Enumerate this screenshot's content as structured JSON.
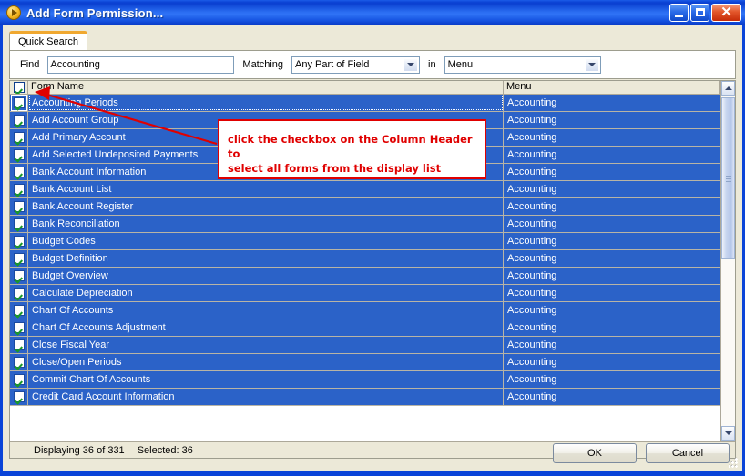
{
  "window": {
    "title": "Add Form Permission...",
    "icon": "play-circle-icon",
    "minimize_label": "Minimize",
    "maximize_label": "Maximize",
    "close_label": "Close",
    "titlebar_color": "#0a44d8",
    "client_color": "#ece9d8"
  },
  "tabs": [
    {
      "label": "Quick Search",
      "active": true,
      "accent_color": "#f0a830"
    }
  ],
  "search": {
    "find_label": "Find",
    "find_value": "Accounting",
    "find_placeholder": "",
    "matching_label": "Matching",
    "matching_value": "Any Part of Field",
    "in_label": "in",
    "in_value": "Menu"
  },
  "grid": {
    "select_all_checked": true,
    "columns": [
      {
        "key": "check",
        "label": ""
      },
      {
        "key": "name",
        "label": "Form Name"
      },
      {
        "key": "menu",
        "label": "Menu"
      }
    ],
    "row_color": "#2b62c8",
    "row_text_color": "#ffffff",
    "rows": [
      {
        "checked": true,
        "name": "Accounting Periods",
        "menu": "Accounting"
      },
      {
        "checked": true,
        "name": "Add Account Group",
        "menu": "Accounting"
      },
      {
        "checked": true,
        "name": "Add Primary Account",
        "menu": "Accounting"
      },
      {
        "checked": true,
        "name": "Add Selected Undeposited Payments",
        "menu": "Accounting"
      },
      {
        "checked": true,
        "name": "Bank Account Information",
        "menu": "Accounting"
      },
      {
        "checked": true,
        "name": "Bank Account List",
        "menu": "Accounting"
      },
      {
        "checked": true,
        "name": "Bank Account Register",
        "menu": "Accounting"
      },
      {
        "checked": true,
        "name": "Bank Reconciliation",
        "menu": "Accounting"
      },
      {
        "checked": true,
        "name": "Budget Codes",
        "menu": "Accounting"
      },
      {
        "checked": true,
        "name": "Budget Definition",
        "menu": "Accounting"
      },
      {
        "checked": true,
        "name": "Budget Overview",
        "menu": "Accounting"
      },
      {
        "checked": true,
        "name": "Calculate Depreciation",
        "menu": "Accounting"
      },
      {
        "checked": true,
        "name": "Chart Of Accounts",
        "menu": "Accounting"
      },
      {
        "checked": true,
        "name": "Chart Of Accounts Adjustment",
        "menu": "Accounting"
      },
      {
        "checked": true,
        "name": "Close Fiscal Year",
        "menu": "Accounting"
      },
      {
        "checked": true,
        "name": "Close/Open Periods",
        "menu": "Accounting"
      },
      {
        "checked": true,
        "name": "Commit Chart Of Accounts",
        "menu": "Accounting"
      },
      {
        "checked": true,
        "name": "Credit Card Account Information",
        "menu": "Accounting"
      }
    ]
  },
  "status": {
    "displaying": "Displaying 36 of 331",
    "selected": "Selected: 36"
  },
  "buttons": {
    "ok": "OK",
    "cancel": "Cancel"
  },
  "annotation": {
    "text": "click the checkbox on the Column Header to\nselect all forms from the display list",
    "color": "#e00000"
  },
  "scrollbar": {
    "up_label": "Scroll up",
    "down_label": "Scroll down"
  }
}
